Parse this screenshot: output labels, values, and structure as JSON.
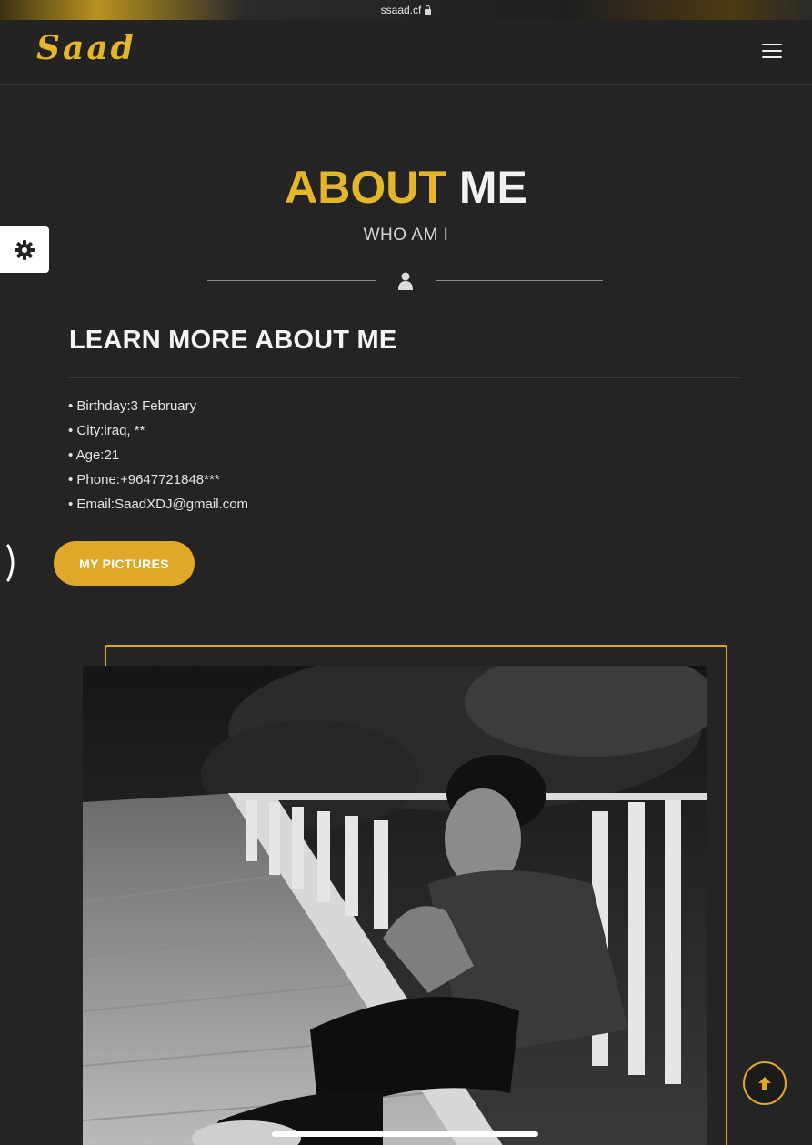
{
  "browser": {
    "url": "ssaad.cf"
  },
  "nav": {
    "brand": "Saad",
    "menu_icon": "hamburger-menu-icon"
  },
  "settings": {
    "icon": "gear-icon"
  },
  "about": {
    "title_highlight": "ABOUT",
    "title_rest": "ME",
    "subtitle": "WHO AM I",
    "divider_icon": "user-icon"
  },
  "learn_more": {
    "title": "LEARN MORE ABOUT ME",
    "items": [
      "• Birthday:3 February",
      "• City:iraq, **",
      "• Age:21",
      "• Phone:+9647721848***",
      "• Email:SaadXDJ@gmail.com"
    ]
  },
  "actions": {
    "pictures_button": "MY PICTURES",
    "side_arrow_icon": "chevron-right-icon",
    "scroll_top_icon": "arrow-up-icon"
  },
  "colors": {
    "accent": "#e0a829",
    "background": "#242424",
    "text": "#f2f2f2"
  }
}
